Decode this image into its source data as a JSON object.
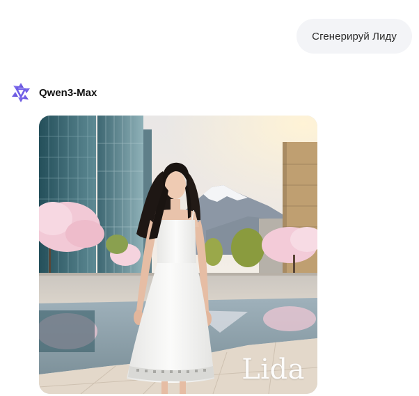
{
  "user_message": {
    "text": "Сгенерируй Лиду"
  },
  "assistant": {
    "name": "Qwen3-Max",
    "logo_icon": "qwen-logo-icon",
    "accent_color": "#6f5ee8"
  },
  "generated_image": {
    "watermark": "Lida"
  }
}
